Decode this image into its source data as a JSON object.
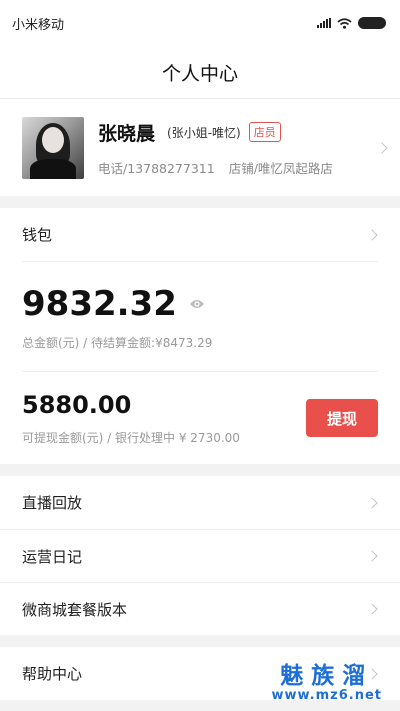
{
  "status_bar": {
    "carrier": "小米移动"
  },
  "nav": {
    "title": "个人中心"
  },
  "profile": {
    "name": "张晓晨",
    "alias": "(张小姐-唯忆)",
    "role": "店员",
    "phone": "电话/13788277311",
    "store": "店铺/唯忆凤起路店"
  },
  "wallet": {
    "label": "钱包",
    "total_amount": "9832.32",
    "total_sub": "总金额(元) / 待结算金额:¥8473.29",
    "withdrawable_amount": "5880.00",
    "withdrawable_sub": "可提现金额(元) / 银行处理中 ¥ 2730.00",
    "withdraw_button": "提现"
  },
  "menu": {
    "live_replay": "直播回放",
    "operation_log": "运营日记",
    "store_plan": "微商城套餐版本",
    "help_center": "帮助中心"
  },
  "watermark": {
    "cn": "魅族溜",
    "en": "www.mz6.net"
  },
  "colors": {
    "accent": "#e9504c",
    "badge": "#e0554f",
    "watermark": "#1d6fd6"
  },
  "icons": [
    "signal-icon",
    "wifi-icon",
    "battery-icon",
    "chevron-right-icon",
    "eye-icon"
  ]
}
